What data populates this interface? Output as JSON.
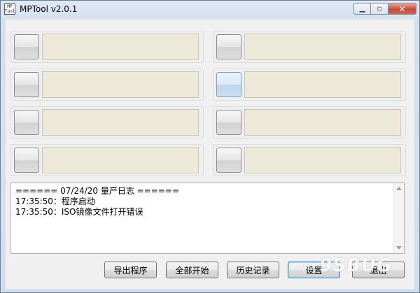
{
  "window": {
    "title": "MPTool v2.0.1",
    "icon_text": "MPTool"
  },
  "log": {
    "lines": [
      "====== 07/24/20 量产日志 ======",
      "17:35:50：程序启动",
      "17:35:50：ISO镜像文件打开错误"
    ]
  },
  "buttons": {
    "export": "导出程序",
    "start_all": "全部开始",
    "history": "历史记录",
    "settings": "设置",
    "exit": "退出"
  },
  "watermark": "9SBUG",
  "colors": {
    "field_bg": "#ece9d8",
    "close_red": "#c74a36"
  }
}
